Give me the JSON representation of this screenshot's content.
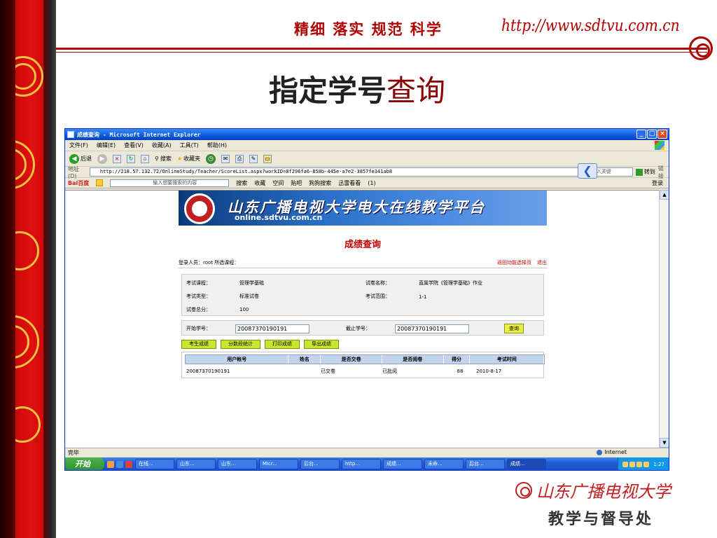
{
  "slide": {
    "slogan": "精细  落实  规范  科学",
    "url": "http://www.sdtvu.com.cn",
    "title_main": "指定学号",
    "title_suffix": "查询",
    "university_logo_text": "山东广播电视大学",
    "department": "教学与督导处"
  },
  "browser": {
    "window_title": "成绩查询 - Microsoft Internet Explorer",
    "menu": [
      "文件(F)",
      "编辑(E)",
      "查看(V)",
      "收藏(A)",
      "工具(T)",
      "帮助(H)"
    ],
    "toolbar": {
      "back": "后退",
      "search": "搜索",
      "favorites": "收藏夹"
    },
    "address_label": "地址(D)",
    "address_url": "http://218.57.132.72/OnlineStudy/Teacher/ScoreList.aspx?workID=8f296fa6-858b-445e-a7e2-3857fe341ab8",
    "address_hint": "←输入关键",
    "go_label": "转到",
    "links_label": "链接",
    "baidu_logo": "Bai百度",
    "baidu_placeholder": "输入想要搜索的内容",
    "baidu_items": [
      "搜索",
      "收藏",
      "空间",
      "贴吧",
      "狗狗搜索",
      "迅雷看看",
      "(1)"
    ],
    "right_items": [
      "登录"
    ],
    "status_text": "完毕",
    "zone_text": "Internet"
  },
  "taskbar": {
    "start": "开始",
    "tasks": [
      "在线...",
      "山东...",
      "山东...",
      "Micr...",
      "后台...",
      "http...",
      "成绩...",
      "未命...",
      "后台...",
      "成绩..."
    ],
    "clock": "1:27"
  },
  "page": {
    "banner_title": "山东广播电视大学电大在线教学平台",
    "banner_url": "online.sdtvu.com.cn",
    "heading": "成绩查询",
    "login_info": "登录人员：root  所选课程：",
    "link_back": "返回功能选择页",
    "link_exit": "退出",
    "info": {
      "course_label": "考试课程：",
      "course_value": "管理学基础",
      "paper_label": "试卷名称：",
      "paper_value": "直属学院《管理学基础》作业",
      "type_label": "考试类型：",
      "type_value": "标准试卷",
      "range_label": "考试范围：",
      "range_value": "1-1",
      "total_label": "试卷总分：",
      "total_value": "100"
    },
    "range": {
      "start_label": "开始学号：",
      "start_value": "20087370190191",
      "end_label": "截止学号：",
      "end_value": "20087370190191",
      "query_button": "查询"
    },
    "actions": [
      "考生成绩",
      "分数段统计",
      "打印成绩",
      "导出成绩"
    ],
    "table": {
      "headers": [
        "用户帐号",
        "姓名",
        "是否交卷",
        "是否阅卷",
        "得分",
        "考试时间"
      ],
      "rows": [
        [
          "20087370190191",
          "",
          "已交卷",
          "已批阅",
          "88",
          "2010-8-17"
        ]
      ]
    }
  }
}
